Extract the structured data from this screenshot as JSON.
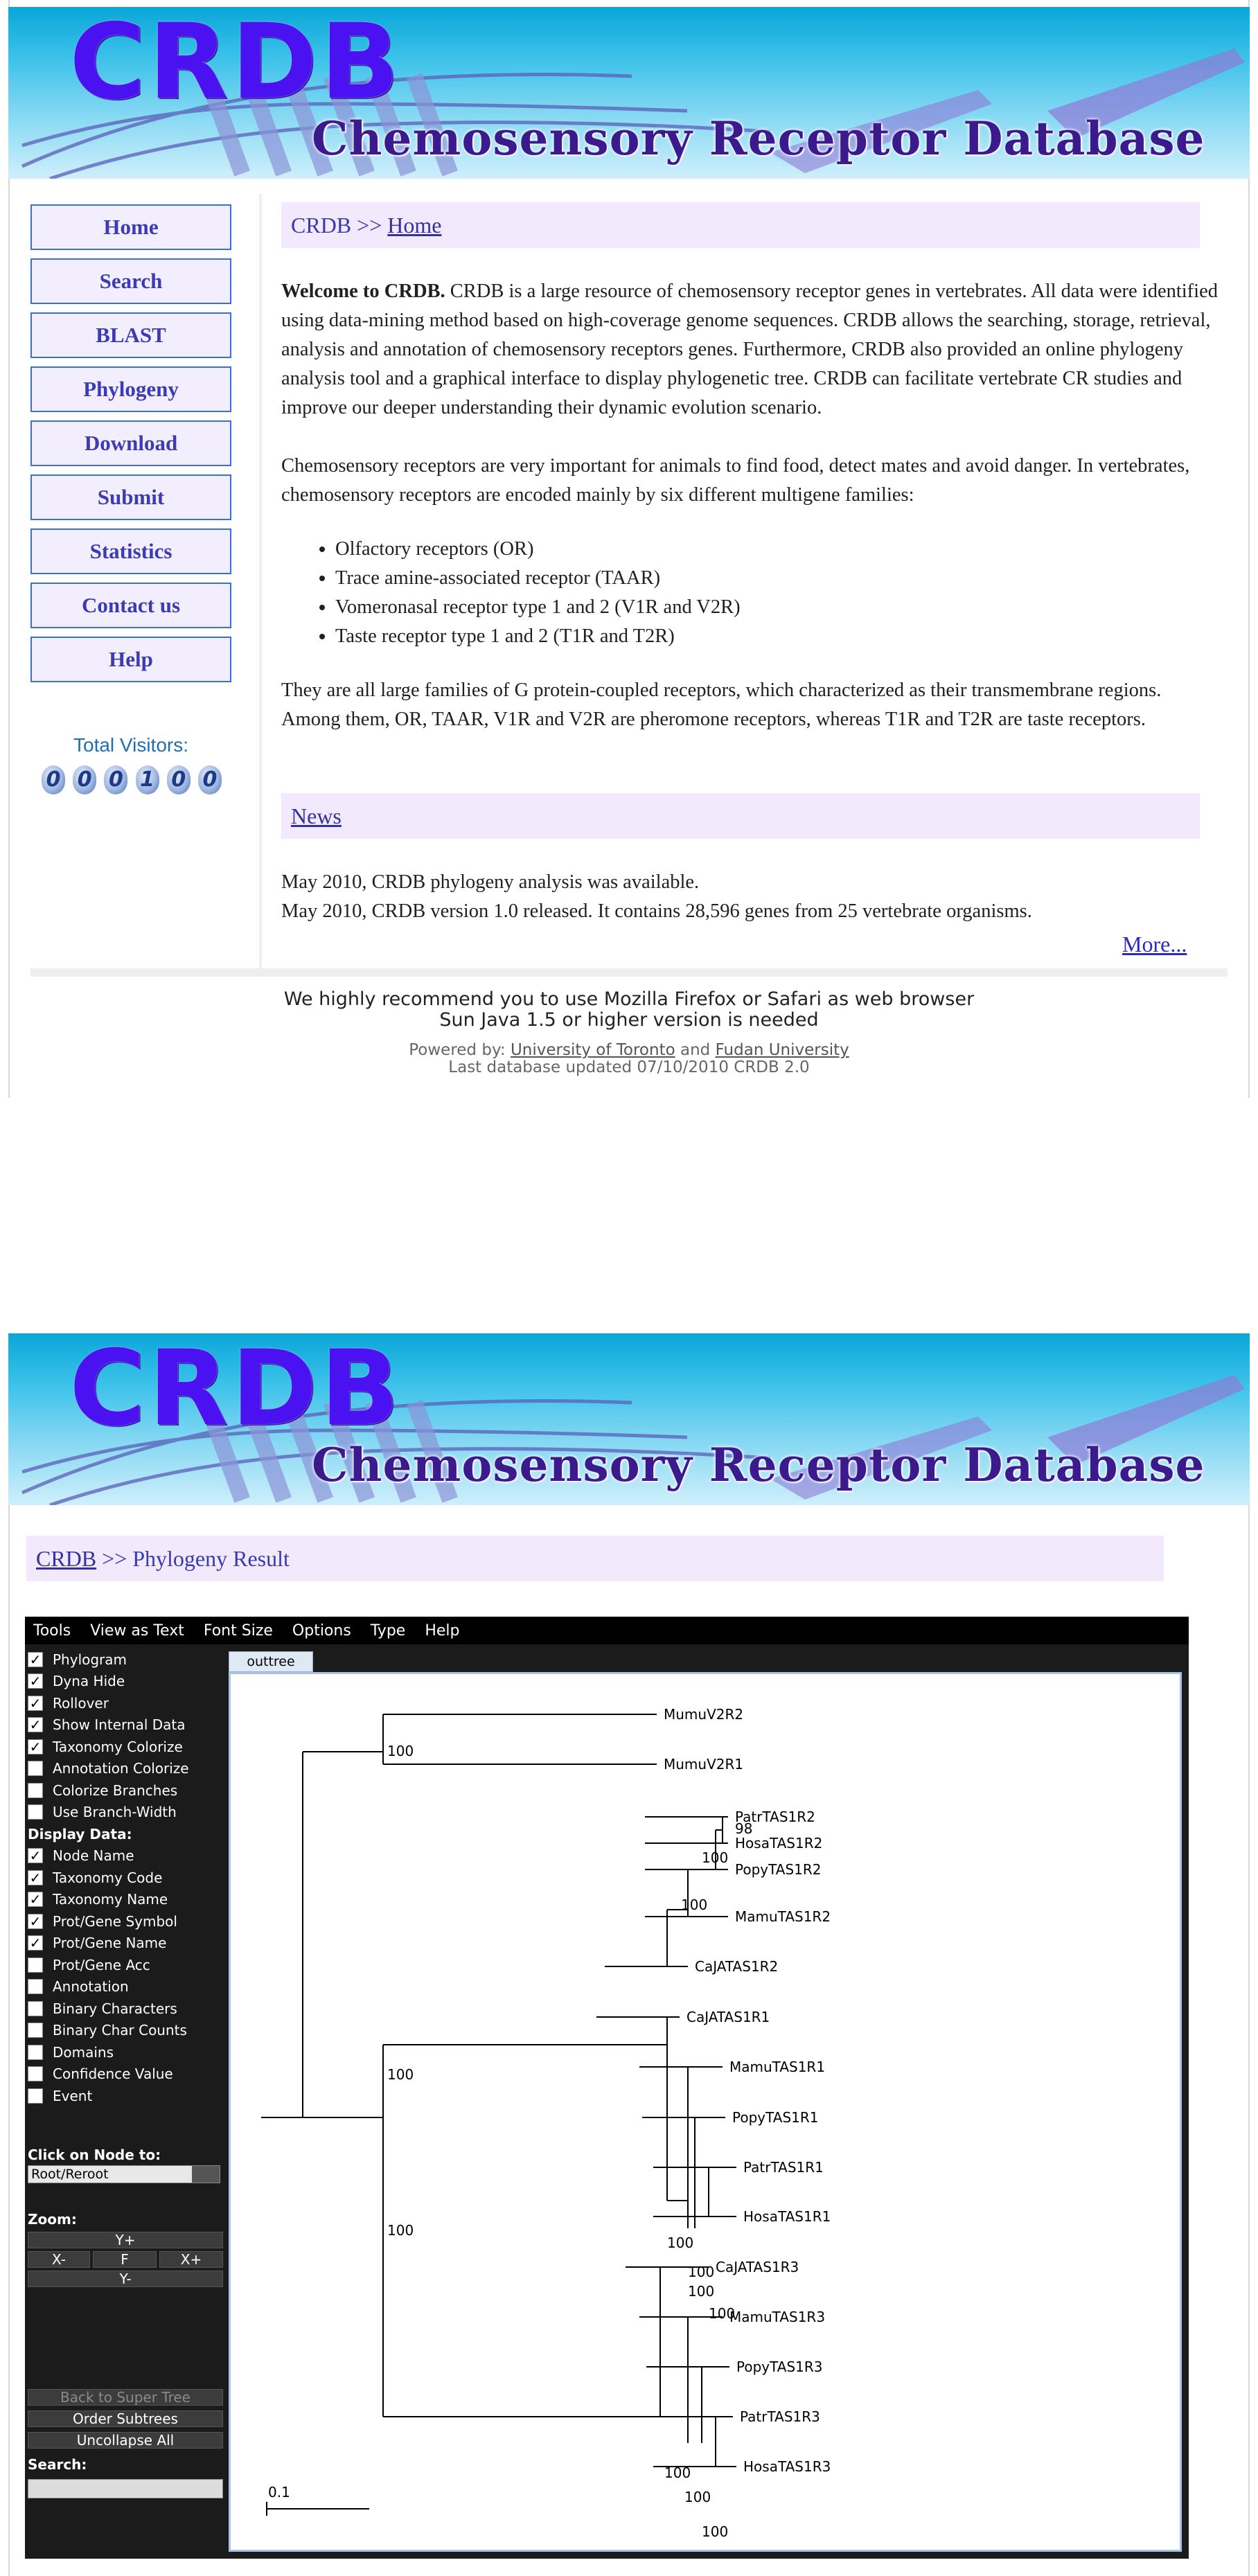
{
  "banner": {
    "logo": "CRDB",
    "subtitle": "Chemosensory Receptor Database"
  },
  "nav": [
    {
      "label": "Home"
    },
    {
      "label": "Search"
    },
    {
      "label": "BLAST"
    },
    {
      "label": "Phylogeny"
    },
    {
      "label": "Download"
    },
    {
      "label": "Submit"
    },
    {
      "label": "Statistics"
    },
    {
      "label": "Contact us"
    },
    {
      "label": "Help"
    }
  ],
  "visitors": {
    "label": "Total Visitors:",
    "digits": [
      "0",
      "0",
      "0",
      "1",
      "0",
      "0"
    ]
  },
  "home": {
    "breadcrumb_root": "CRDB >> ",
    "breadcrumb_current": "Home",
    "welcome_bold": "Welcome to CRDB.",
    "welcome_text": " CRDB is a large resource of chemosensory receptor genes in vertebrates. All data were identified using data-mining method based on high-coverage genome sequences. CRDB allows the searching, storage, retrieval, analysis and annotation of chemosensory receptors genes. Furthermore, CRDB also provided an online phylogeny analysis tool and a graphical interface to display phylogenetic tree. CRDB can facilitate vertebrate CR studies and improve our deeper understanding their dynamic evolution scenario.",
    "para2": "Chemosensory receptors are very important for animals to find food, detect mates and avoid danger. In vertebrates, chemosensory receptors are encoded mainly by six different multigene families:",
    "families": [
      "Olfactory receptors (OR)",
      "Trace amine-associated receptor (TAAR)",
      "Vomeronasal receptor type 1 and 2 (V1R and V2R)",
      "Taste receptor type 1 and 2 (T1R and T2R)"
    ],
    "para3": "They are all large families of G protein-coupled receptors, which characterized as their transmembrane regions. Among them, OR, TAAR, V1R and V2R are pheromone receptors, whereas T1R and T2R are taste receptors.",
    "news_title": "News",
    "news": [
      "May 2010, CRDB phylogeny analysis was available.",
      "May 2010, CRDB version 1.0 released. It contains 28,596 genes from 25 vertebrate organisms."
    ],
    "more": "More..."
  },
  "footer": {
    "line1": "We highly recommend you to use Mozilla Firefox or Safari as web browser",
    "line2": "Sun Java 1.5 or higher version is needed",
    "powered_prefix": "Powered by: ",
    "uoft": "University of Toronto",
    "and": " and ",
    "fudan": "Fudan University",
    "updated": "Last database updated 07/10/2010 CRDB 2.0"
  },
  "phylo": {
    "breadcrumb_root": "CRDB",
    "breadcrumb_rest": " >> Phylogeny Result",
    "menu": [
      "Tools",
      "View as Text",
      "Font Size",
      "Options",
      "Type",
      "Help"
    ],
    "options": [
      {
        "label": "Phylogram",
        "checked": true
      },
      {
        "label": "Dyna Hide",
        "checked": true
      },
      {
        "label": "Rollover",
        "checked": true
      },
      {
        "label": "Show Internal Data",
        "checked": true
      },
      {
        "label": "Taxonomy Colorize",
        "checked": true
      },
      {
        "label": "Annotation Colorize",
        "checked": false
      },
      {
        "label": "Colorize Branches",
        "checked": false
      },
      {
        "label": "Use Branch-Width",
        "checked": false
      }
    ],
    "display_data_label": "Display Data:",
    "display_data": [
      {
        "label": "Node Name",
        "checked": true
      },
      {
        "label": "Taxonomy Code",
        "checked": true
      },
      {
        "label": "Taxonomy Name",
        "checked": true
      },
      {
        "label": "Prot/Gene Symbol",
        "checked": true
      },
      {
        "label": "Prot/Gene Name",
        "checked": true
      },
      {
        "label": "Prot/Gene Acc",
        "checked": false
      },
      {
        "label": "Annotation",
        "checked": false
      },
      {
        "label": "Binary Characters",
        "checked": false
      },
      {
        "label": "Binary Char Counts",
        "checked": false
      },
      {
        "label": "Domains",
        "checked": false
      },
      {
        "label": "Confidence Value",
        "checked": false
      },
      {
        "label": "Event",
        "checked": false
      }
    ],
    "click_node_label": "Click on Node to:",
    "click_node_value": "Root/Reroot",
    "zoom_label": "Zoom:",
    "zoom": {
      "yplus": "Y+",
      "xminus": "X-",
      "f": "F",
      "xplus": "X+",
      "yminus": "Y-"
    },
    "back_super": "Back to Super Tree",
    "order_subtrees": "Order Subtrees",
    "uncollapse": "Uncollapse All",
    "search_label": "Search:",
    "tab": "outtree",
    "scale_label": "0.1",
    "leaves": [
      "MumuV2R2",
      "MumuV2R1",
      "PatrTAS1R2",
      "HosaTAS1R2",
      "PopyTAS1R2",
      "MamuTAS1R2",
      "CaJATAS1R2",
      "CaJATAS1R1",
      "MamuTAS1R1",
      "PopyTAS1R1",
      "PatrTAS1R1",
      "HosaTAS1R1",
      "CaJATAS1R3",
      "MamuTAS1R3",
      "PopyTAS1R3",
      "PatrTAS1R3",
      "HosaTAS1R3"
    ],
    "support": [
      "100",
      "98",
      "100",
      "100",
      "100",
      "100",
      "100",
      "100",
      "100",
      "100",
      "100",
      "100",
      "100",
      "100",
      "100"
    ]
  }
}
